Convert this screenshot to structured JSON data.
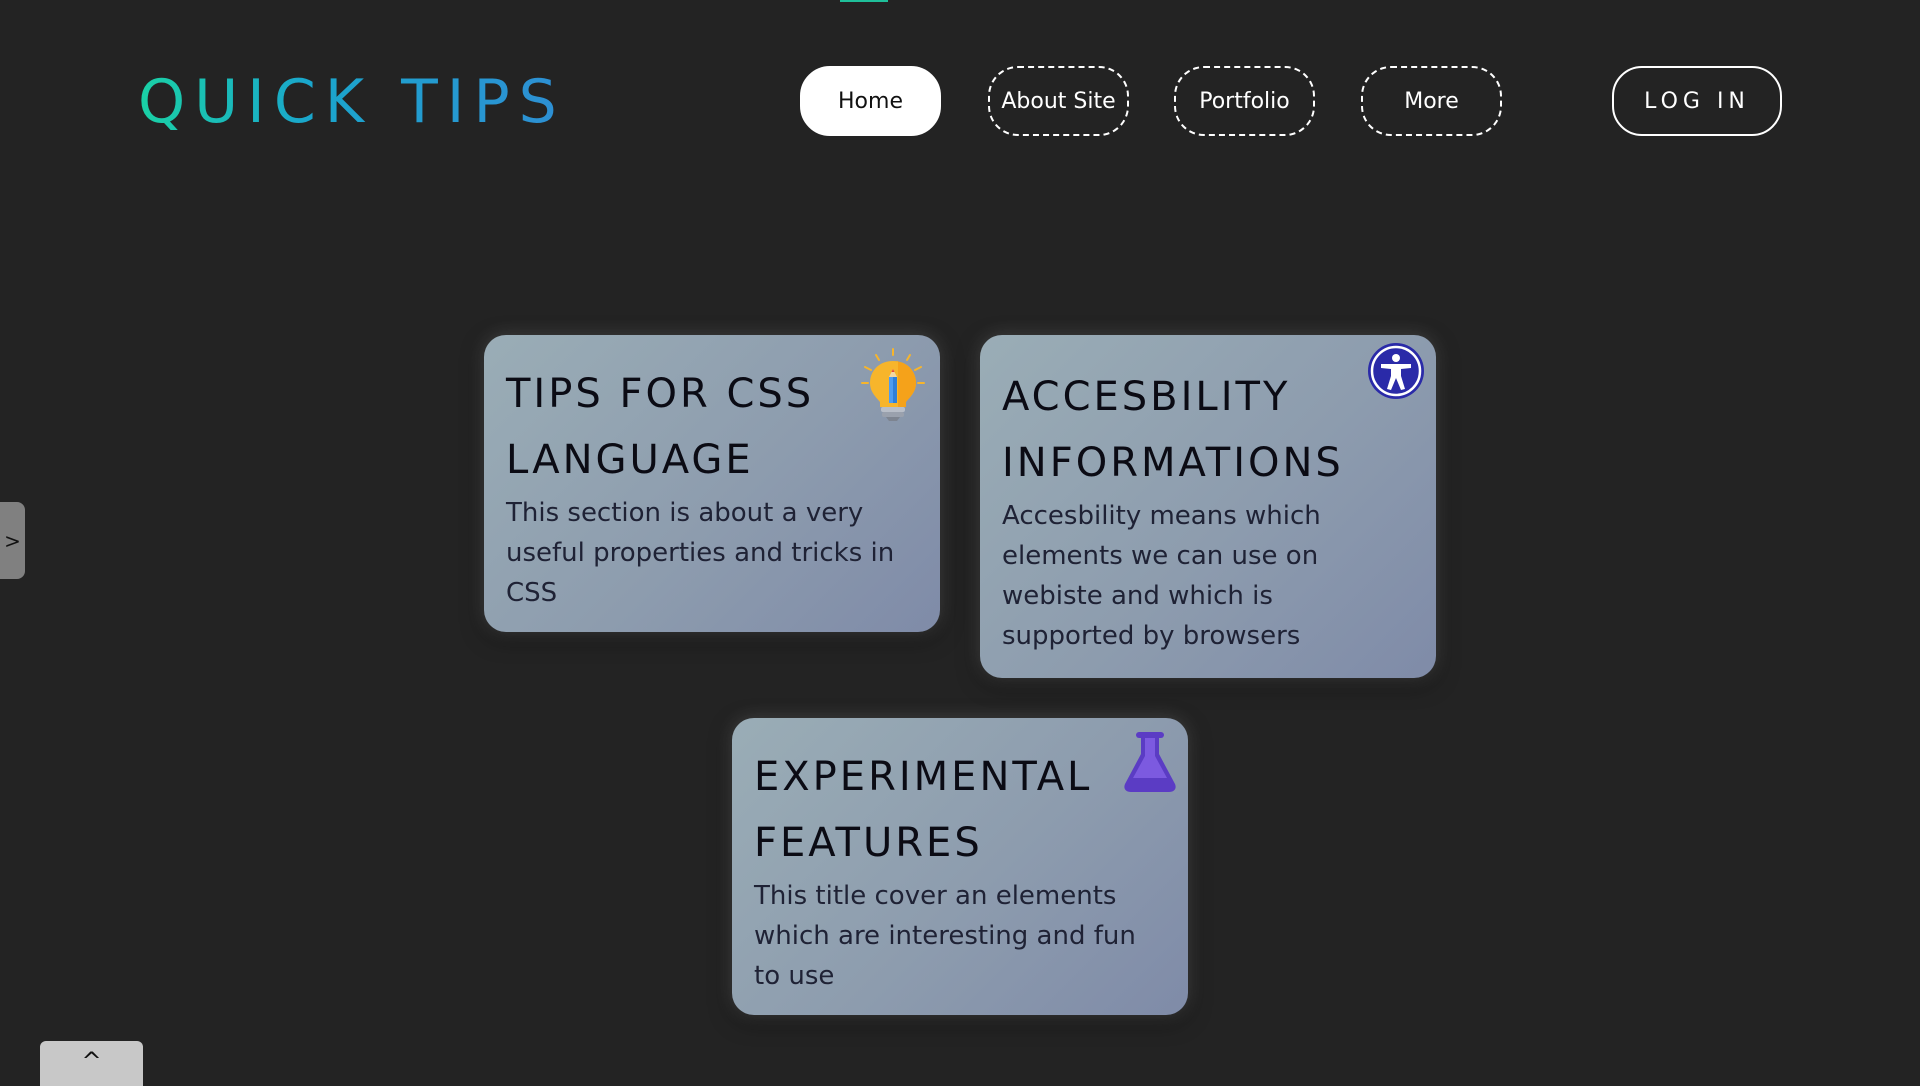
{
  "header": {
    "logo": "QUICK TIPS",
    "nav": [
      {
        "label": "Home",
        "active": true
      },
      {
        "label": "About Site",
        "active": false
      },
      {
        "label": "Portfolio",
        "active": false
      },
      {
        "label": "More",
        "active": false
      }
    ],
    "login_label": "LOG IN"
  },
  "cards": [
    {
      "title": "TIPS FOR CSS LANGUAGE",
      "text": "This section is about a very useful properties and tricks in CSS",
      "icon": "lightbulb-pencil-icon"
    },
    {
      "title": "ACCESBILITY INFORMATIONS",
      "text": "Accesbility means which elements we can use on webiste and which is supported by browsers",
      "icon": "accessibility-icon"
    },
    {
      "title": "EXPERIMENTAL FEATURES",
      "text": "This title cover an elements which are interesting and fun to use",
      "icon": "flask-icon"
    }
  ],
  "side_tab": {
    "glyph": ">"
  },
  "scroll_top": {
    "glyph": "^"
  },
  "colors": {
    "background": "#232323",
    "logo_gradient_start": "#1ad1a5",
    "logo_gradient_end": "#2e8fd4",
    "accessibility_icon": "#2a2aa8",
    "flask_icon": "#5b3cc4",
    "bulb_icon": "#f7b52b"
  }
}
